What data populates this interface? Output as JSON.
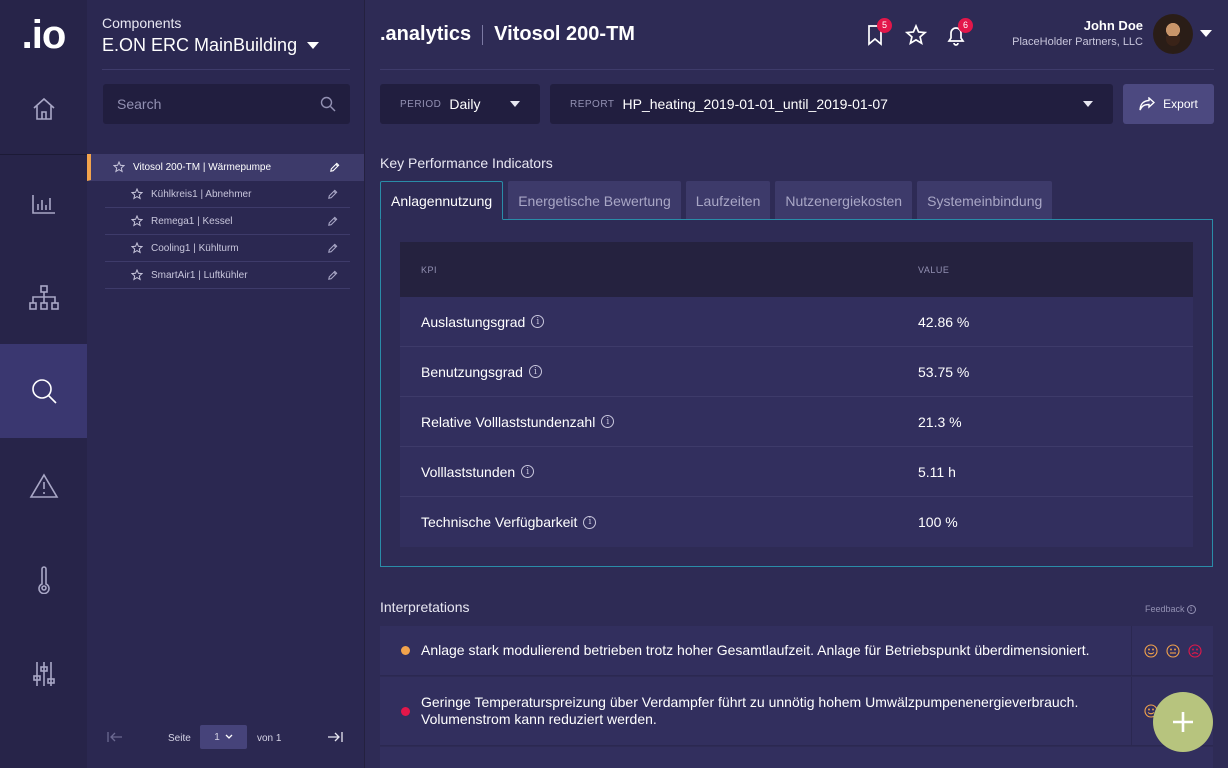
{
  "app": {
    "logo": ".io",
    "brand": ".analytics",
    "page_title": "Vitosol 200-TM"
  },
  "nav": [
    "home-icon",
    "chart-icon",
    "hierarchy-icon",
    "search-icon",
    "alert-icon",
    "thermometer-icon",
    "sliders-icon"
  ],
  "components": {
    "label": "Components",
    "building": "E.ON ERC MainBuilding",
    "search_placeholder": "Search",
    "items": [
      {
        "name": "Vitosol 200-TM | Wärmepumpe",
        "active": true
      },
      {
        "name": "Kühlkreis1 | Abnehmer",
        "active": false
      },
      {
        "name": "Remega1 | Kessel",
        "active": false
      },
      {
        "name": "Cooling1 | Kühlturm",
        "active": false
      },
      {
        "name": "SmartAir1 | Luftkühler",
        "active": false
      }
    ],
    "pager": {
      "seite": "Seite",
      "page": "1",
      "von": "von 1"
    }
  },
  "header": {
    "bookmark_count": "5",
    "notification_count": "6",
    "user_name": "John Doe",
    "user_company": "PlaceHolder Partners, LLC"
  },
  "toolbar": {
    "period_label": "PERIOD",
    "period_value": "Daily",
    "report_label": "REPORT",
    "report_value": "HP_heating_2019-01-01_until_2019-01-07",
    "export_label": "Export"
  },
  "kpi": {
    "title": "Key Performance Indicators",
    "tabs": [
      "Anlagennutzung",
      "Energetische Bewertung",
      "Laufzeiten",
      "Nutzenergiekosten",
      "Systemeinbindung"
    ],
    "col_kpi": "KPI",
    "col_value": "VALUE",
    "rows": [
      {
        "name": "Auslastungsgrad",
        "value": "42.86 %"
      },
      {
        "name": "Benutzungsgrad",
        "value": "53.75 %"
      },
      {
        "name": "Relative Volllaststundenzahl",
        "value": "21.3 %"
      },
      {
        "name": "Volllaststunden",
        "value": "5.11 h"
      },
      {
        "name": "Technische Verfügbarkeit",
        "value": "100 %"
      }
    ]
  },
  "interpretations": {
    "title": "Interpretations",
    "feedback_label": "Feedback",
    "items": [
      {
        "text": "Anlage stark modulierend betrieben trotz hoher Gesamtlaufzeit. Anlage für Betriebspunkt überdimensioniert.",
        "severity_color": "#f2a34c"
      },
      {
        "text": "Geringe Temperaturspreizung über Verdampfer führt zu unnötig hohem Umwälzpumpenenergieverbrauch. Volumenstrom kann reduziert werden.",
        "severity_color": "#e3174a"
      }
    ]
  },
  "colors": {
    "accent": "#2a8ca8",
    "warning": "#f2a34c",
    "danger": "#e3174a",
    "fab": "#b7c47e"
  }
}
